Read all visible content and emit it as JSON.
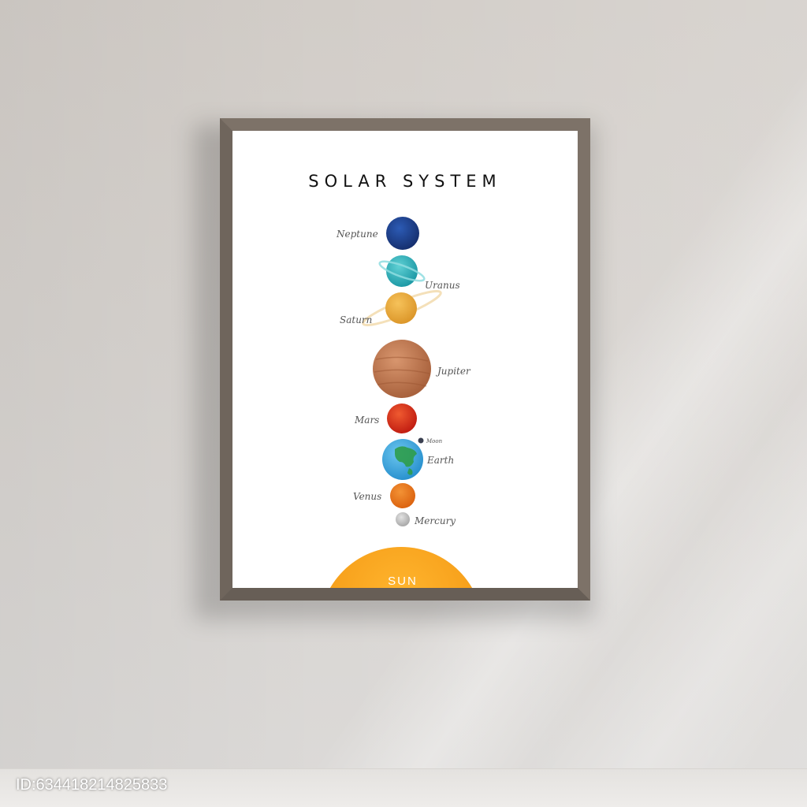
{
  "poster": {
    "title": "SOLAR SYSTEM",
    "sun_label": "SUN"
  },
  "planets": {
    "neptune": "Neptune",
    "uranus": "Uranus",
    "saturn": "Saturn",
    "jupiter": "Jupiter",
    "mars": "Mars",
    "moon": "Moon",
    "earth": "Earth",
    "venus": "Venus",
    "mercury": "Mercury"
  },
  "watermark": "ID:634418214825833",
  "colors": {
    "frame": "#7d7268",
    "sun": "#f7a21c",
    "neptune": "#1f3f8f",
    "uranus": "#2ab0b8",
    "saturn": "#e8a93a",
    "jupiter": "#c07a55",
    "mars": "#d8321e",
    "earth": "#3aa6dc",
    "venus": "#e8741c",
    "mercury": "#c8c8c8"
  }
}
